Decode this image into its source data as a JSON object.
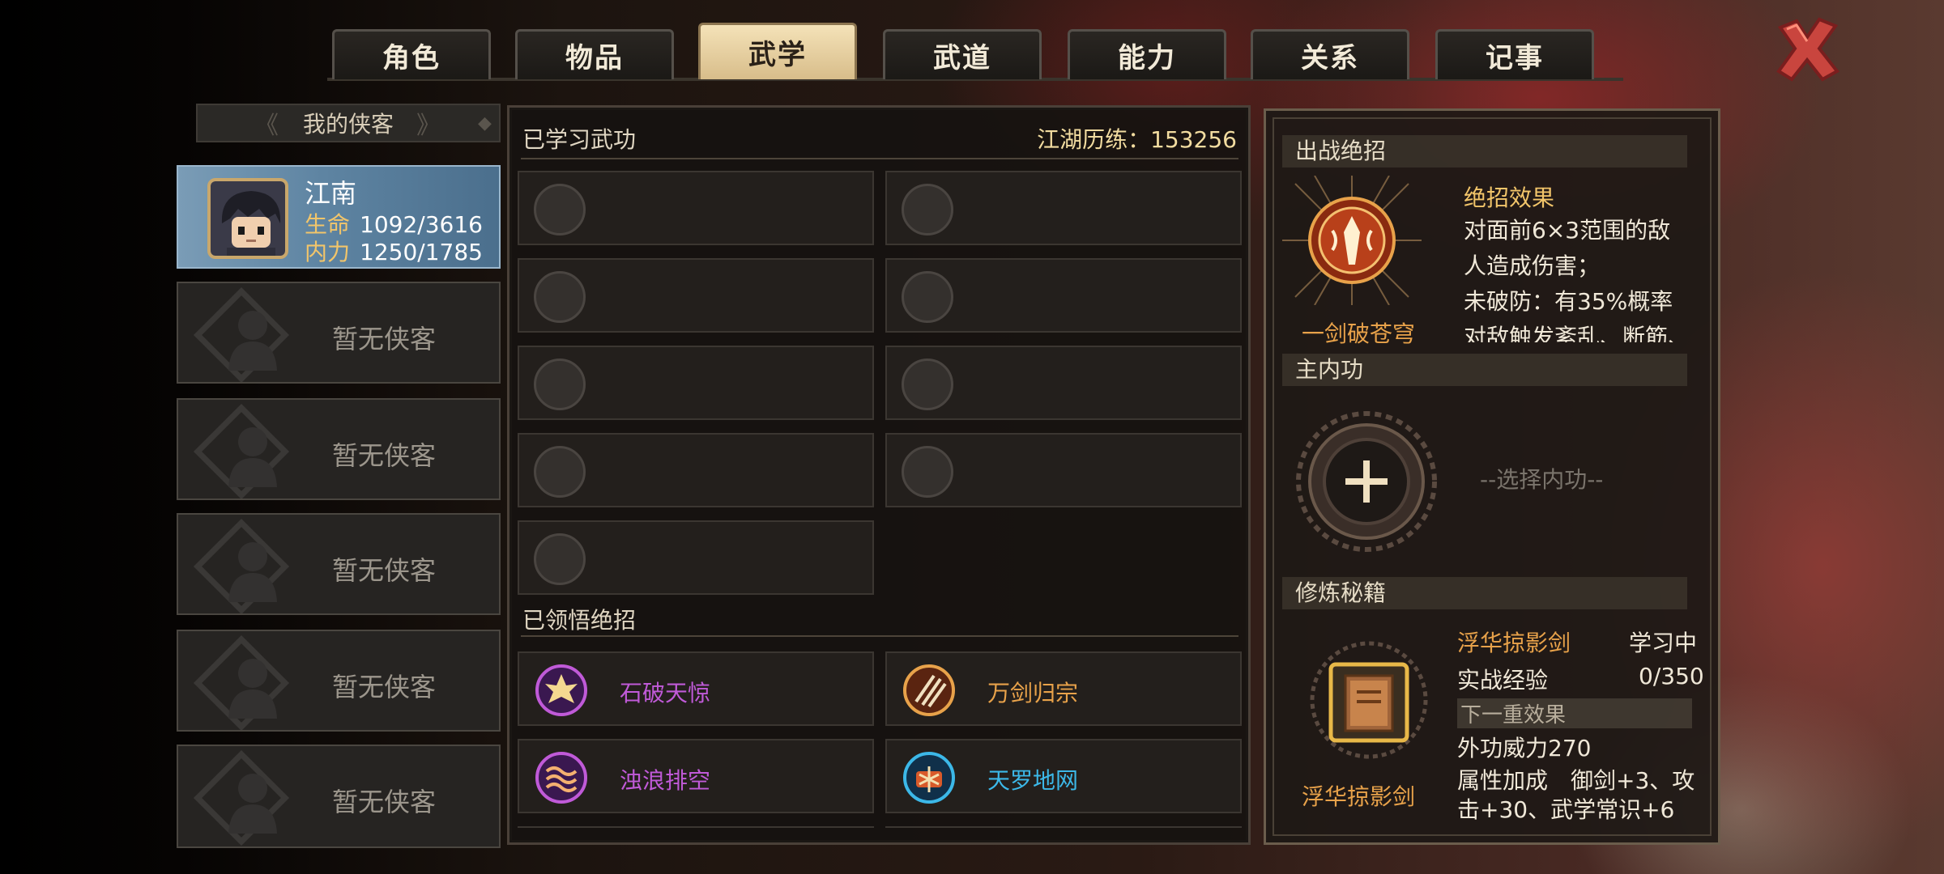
{
  "tabs": [
    "角色",
    "物品",
    "武学",
    "武道",
    "能力",
    "关系",
    "记事"
  ],
  "active_tab": "武学",
  "roster": {
    "header": "我的侠客",
    "hero": {
      "name": "江南",
      "hp_label": "生命",
      "hp_value": "1092/3616",
      "mp_label": "内力",
      "mp_value": "1250/1785"
    },
    "empty_label": "暂无侠客",
    "empty_slots": 5
  },
  "learned": {
    "title": "已学习武功",
    "jianghu_label": "江湖历练：",
    "jianghu_value": "153256",
    "empty_slot_count": 9
  },
  "ultimates": {
    "title": "已领悟绝招",
    "items": [
      {
        "name": "石破天惊",
        "color": "#c05ad8",
        "icon": "burst-icon"
      },
      {
        "name": "万剑归宗",
        "color": "#e8a24a",
        "icon": "sword-rain-icon"
      },
      {
        "name": "浊浪排空",
        "color": "#c05ad8",
        "icon": "wave-icon"
      },
      {
        "name": "天罗地网",
        "color": "#3cb8e8",
        "icon": "net-icon"
      }
    ]
  },
  "battle_ult": {
    "head": "出战绝招",
    "name": "一剑破苍穹",
    "effect_title": "绝招效果",
    "effect_lines": [
      "对面前6×3范围的敌",
      "人造成伤害；",
      "未破防：有35%概率",
      "对敌触发紊乱、断筋、"
    ]
  },
  "main_inner": {
    "head": "主内功",
    "placeholder": "--选择内功--"
  },
  "training": {
    "head": "修炼秘籍",
    "book_name": "浮华掠影剑",
    "status": "学习中",
    "exp_label": "实战经验",
    "exp_value": "0/350",
    "next_label": "下一重效果",
    "power_label": "外功威力",
    "power_value": "270",
    "attr_label": "属性加成",
    "attr_line1": "御剑+3、攻",
    "attr_line2": "击+30、武学常识+6",
    "book_caption": "浮华掠影剑"
  }
}
